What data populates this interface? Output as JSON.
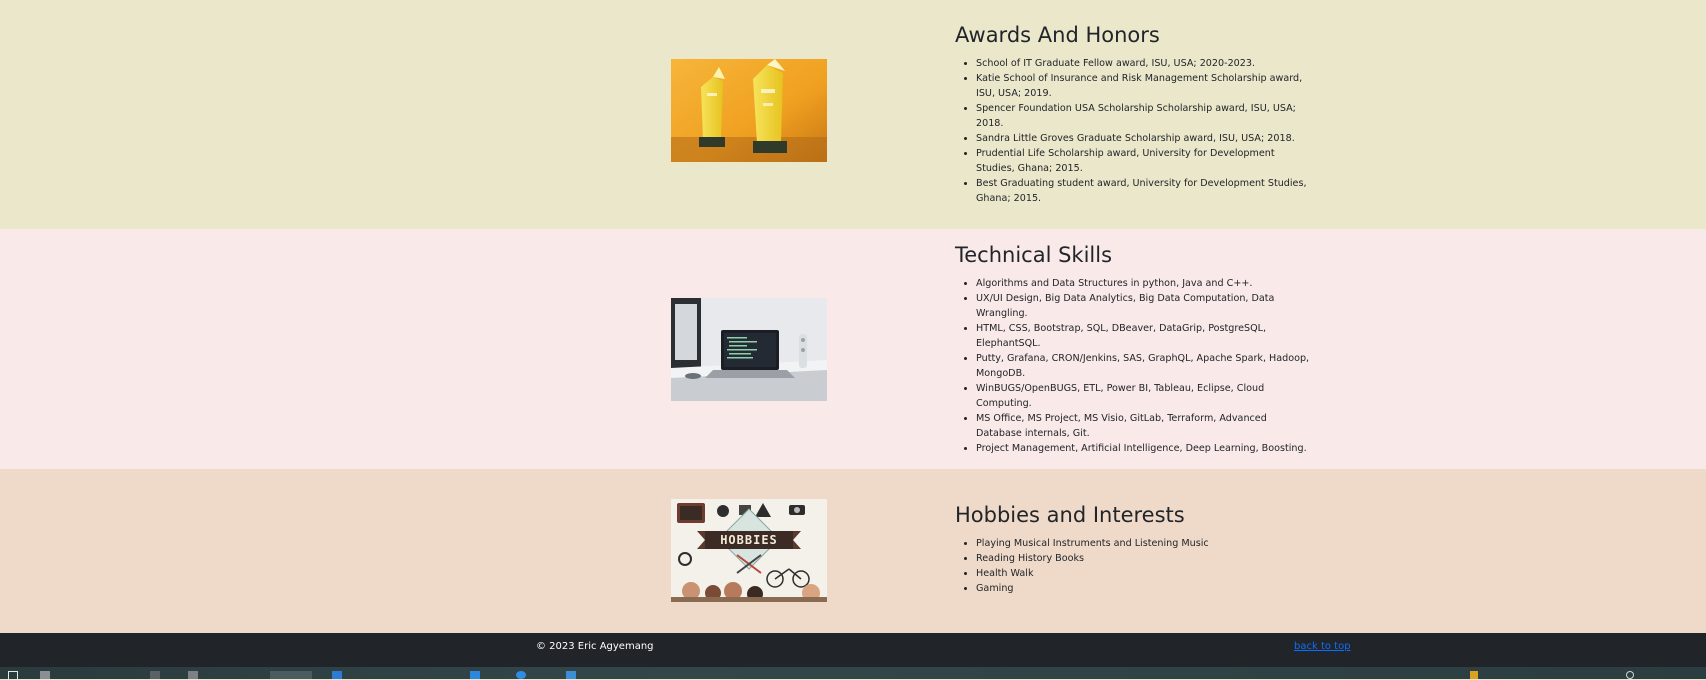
{
  "sections": {
    "awards": {
      "title": "Awards And Honors",
      "image_alt": "trophy-image",
      "items": [
        "School of IT Graduate Fellow award, ISU, USA; 2020-2023.",
        "Katie School of Insurance and Risk Management Scholarship award, ISU, USA; 2019.",
        "Spencer Foundation USA Scholarship Scholarship award, ISU, USA; 2018.",
        "Sandra Little Groves Graduate Scholarship award, ISU, USA; 2018.",
        "Prudential Life Scholarship award, University for Development Studies, Ghana; 2015.",
        "Best Graduating student award, University for Development Studies, Ghana; 2015."
      ]
    },
    "skills": {
      "title": "Technical Skills",
      "image_alt": "laptop-desk-image",
      "items": [
        "Algorithms and Data Structures in python, Java and C++.",
        "UX/UI Design, Big Data Analytics, Big Data Computation, Data Wrangling.",
        "HTML, CSS, Bootstrap, SQL, DBeaver, DataGrip, PostgreSQL, ElephantSQL.",
        "Putty, Grafana, CRON/Jenkins, SAS, GraphQL, Apache Spark, Hadoop, MongoDB.",
        "WinBUGS/OpenBUGS, ETL, Power BI, Tableau, Eclipse, Cloud Computing.",
        "MS Office, MS Project, MS Visio, GitLab, Terraform, Advanced Database internals, Git.",
        "Project Management, Artificial Intelligence, Deep Learning, Boosting."
      ]
    },
    "hobbies": {
      "title": "Hobbies and Interests",
      "image_label": "HOBBIES",
      "items": [
        "Playing Musical Instruments and Listening Music",
        "Reading History Books",
        "Health Walk",
        "Gaming"
      ]
    }
  },
  "footer": {
    "copyright": "© 2023 Eric Agyemang",
    "back_to_top": "back to top"
  },
  "colors": {
    "awards_bg": "#ebe7cb",
    "skills_bg": "#fae9e9",
    "hobbies_bg": "#efdaca",
    "footer_bg": "#212529",
    "link": "#0d6efd"
  }
}
